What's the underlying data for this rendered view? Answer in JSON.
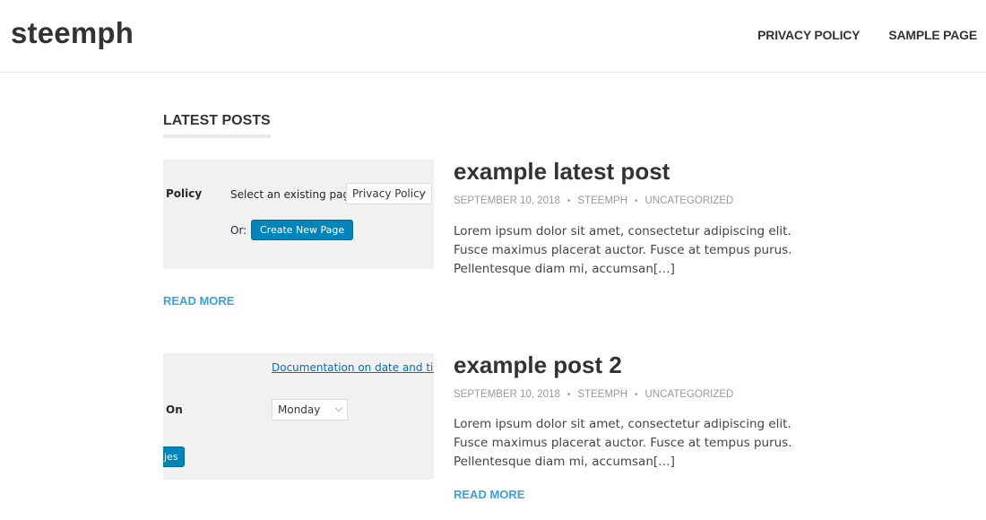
{
  "site": {
    "title": "steemph"
  },
  "nav": {
    "items": [
      {
        "label": "PRIVACY POLICY"
      },
      {
        "label": "SAMPLE PAGE"
      }
    ]
  },
  "section": {
    "heading": "LATEST POSTS"
  },
  "posts": [
    {
      "title": "example latest post",
      "date": "SEPTEMBER 10, 2018",
      "author": "STEEMPH",
      "category": "UNCATEGORIZED",
      "excerpt": "Lorem ipsum dolor sit amet, consectetur adipiscing elit. Fusce maximus placerat auctor. Fusce at tempus purus. Pellentesque diam mi, accumsan[…]",
      "read_more": "READ MORE",
      "thumb": {
        "label": "Policy",
        "select_label": "Select an existing page:",
        "select_value": "Privacy Policy",
        "or_label": "Or:",
        "button": "Create New Page"
      }
    },
    {
      "title": "example post 2",
      "date": "SEPTEMBER 10, 2018",
      "author": "STEEMPH",
      "category": "UNCATEGORIZED",
      "excerpt": "Lorem ipsum dolor sit amet, consectetur adipiscing elit. Fusce maximus placerat auctor. Fusce at tempus purus. Pellentesque diam mi, accumsan[…]",
      "read_more": "READ MORE",
      "thumb": {
        "link": "Documentation on date and time fo",
        "label": "On",
        "select_value": "Monday",
        "button_partial": "jes"
      }
    }
  ],
  "meta_separator": "•",
  "colors": {
    "accent": "#3aa0d8",
    "text": "#333333",
    "meta": "#999999",
    "wp_button": "#0085ba"
  }
}
